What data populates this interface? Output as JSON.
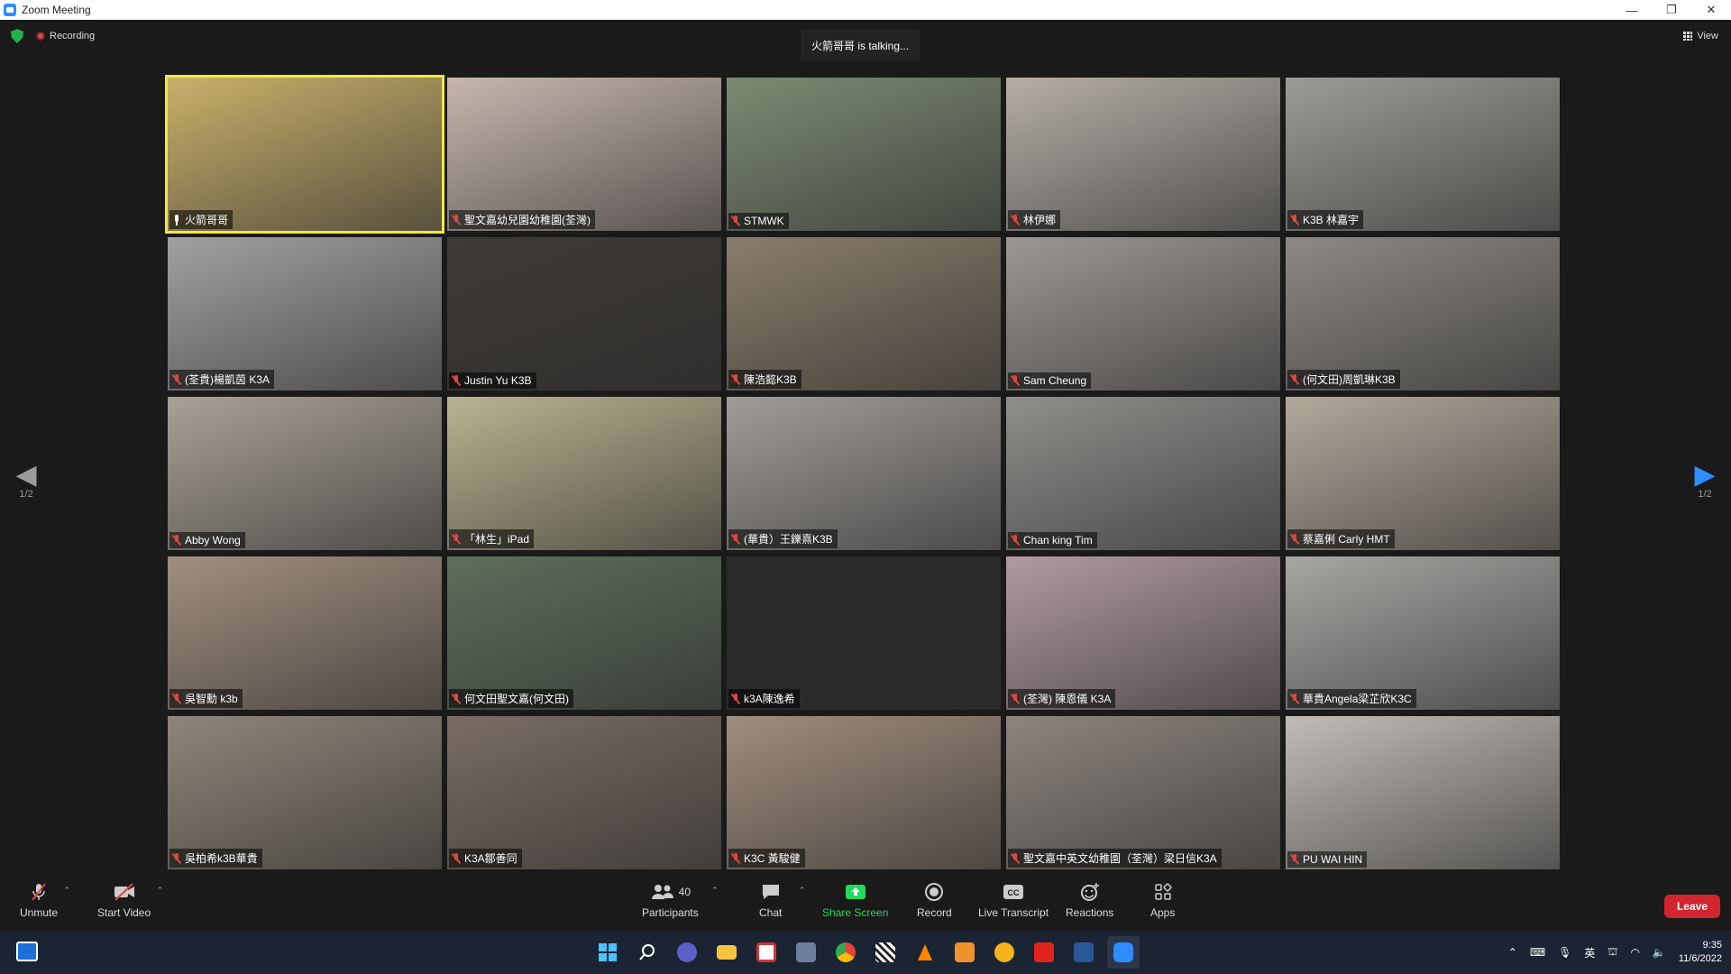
{
  "window": {
    "title": "Zoom Meeting",
    "controls": [
      "—",
      "❐",
      "✕"
    ]
  },
  "topbar": {
    "recording_label": "Recording",
    "talking_text": "火箭哥哥 is talking...",
    "view_label": "View"
  },
  "pagination": {
    "left": "1/2",
    "right": "1/2"
  },
  "participants_grid": [
    {
      "name": "火箭哥哥",
      "muted": false,
      "active": true,
      "bg": "#c9b06a"
    },
    {
      "name": "聖文嘉幼兒園幼稚園(荃灣)",
      "muted": true,
      "active": false,
      "bg": "#c7b7ad"
    },
    {
      "name": "STMWK",
      "muted": true,
      "active": false,
      "bg": "#7c8a72"
    },
    {
      "name": "林伊娜",
      "muted": true,
      "active": false,
      "bg": "#b4aea6"
    },
    {
      "name": "K3B 林嘉宇",
      "muted": true,
      "active": false,
      "bg": "#9d9b95"
    },
    {
      "name": "(荃貴)楊凱茵 K3A",
      "muted": true,
      "active": false,
      "bg": "#a3a19f"
    },
    {
      "name": "Justin Yu K3B",
      "muted": true,
      "active": false,
      "bg": "#3e3a35"
    },
    {
      "name": "陳浩懿K3B",
      "muted": true,
      "active": false,
      "bg": "#8a7d6a"
    },
    {
      "name": "Sam Cheung",
      "muted": true,
      "active": false,
      "bg": "#9c9792"
    },
    {
      "name": "(何文田)周凱琳K3B",
      "muted": true,
      "active": false,
      "bg": "#8d8983"
    },
    {
      "name": "Abby Wong",
      "muted": true,
      "active": false,
      "bg": "#a8a196"
    },
    {
      "name": "「林生」iPad",
      "muted": true,
      "active": false,
      "bg": "#b9b38f"
    },
    {
      "name": "(華貴）王鑠熹K3B",
      "muted": true,
      "active": false,
      "bg": "#a09c98"
    },
    {
      "name": "Chan king Tim",
      "muted": true,
      "active": false,
      "bg": "#8e8f8b"
    },
    {
      "name": "蔡嘉俐 Carly HMT",
      "muted": true,
      "active": false,
      "bg": "#b3a99b"
    },
    {
      "name": "吳智勳 k3b",
      "muted": true,
      "active": false,
      "bg": "#a18f7e"
    },
    {
      "name": "何文田聖文嘉(何文田)",
      "muted": true,
      "active": false,
      "bg": "#5d6f5a"
    },
    {
      "name": "k3A陳逸希",
      "muted": true,
      "active": false,
      "bg": "#2a2a2a"
    },
    {
      "name": "(荃灣) 陳恩儀 K3A",
      "muted": true,
      "active": false,
      "bg": "#b09aa0"
    },
    {
      "name": "華貴Angela梁芷欣K3C",
      "muted": true,
      "active": false,
      "bg": "#a7a6a3"
    },
    {
      "name": "吳柏希k3B華貴",
      "muted": true,
      "active": false,
      "bg": "#8f8678"
    },
    {
      "name": "K3A鄒善同",
      "muted": true,
      "active": false,
      "bg": "#7a6d63"
    },
    {
      "name": "K3C 黃駿健",
      "muted": true,
      "active": false,
      "bg": "#a08d7c"
    },
    {
      "name": "聖文嘉中英文幼稚園（荃灣）梁日信K3A",
      "muted": true,
      "active": false,
      "bg": "#8d857e"
    },
    {
      "name": "PU WAI HIN",
      "muted": true,
      "active": false,
      "bg": "#c1bcb6"
    }
  ],
  "toolbar": {
    "unmute": "Unmute",
    "start_video": "Start Video",
    "participants": "Participants",
    "participants_count": "40",
    "chat": "Chat",
    "share_screen": "Share Screen",
    "record": "Record",
    "live_transcript": "Live Transcript",
    "reactions": "Reactions",
    "apps": "Apps",
    "leave": "Leave",
    "colors": {
      "share": "#23d959",
      "leave": "#d1262f"
    }
  },
  "taskbar": {
    "apps": [
      "start-icon",
      "search-icon",
      "teams-chat-icon",
      "file-explorer-icon",
      "snipping-tool-icon",
      "calculator-icon",
      "chrome-icon",
      "clapper-icon",
      "vlc-icon",
      "media-player-icon",
      "sun-icon",
      "acrobat-icon",
      "word-icon",
      "zoom-icon"
    ],
    "ime_label": "英",
    "time": "9:35",
    "date": "11/6/2022"
  }
}
